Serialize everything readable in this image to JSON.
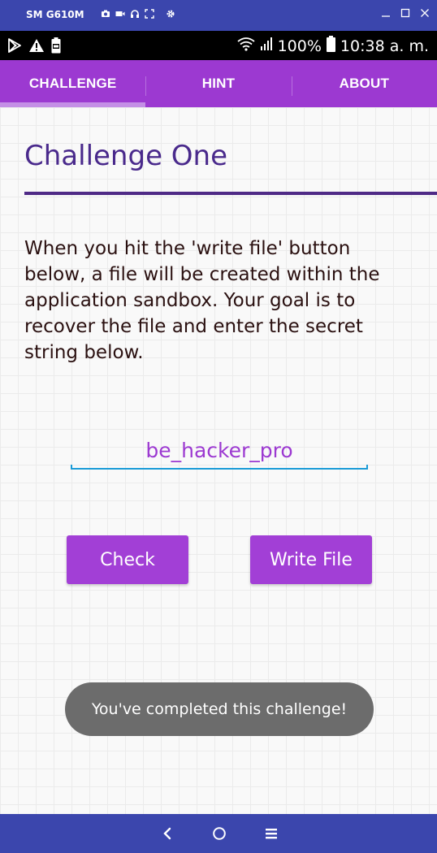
{
  "window": {
    "title": "SM G610M",
    "tool_icons": [
      "camera-icon",
      "video-icon",
      "headphones-icon",
      "fullscreen-icon",
      "settings-gear-icon"
    ],
    "controls": [
      "minimize-icon",
      "maximize-icon",
      "close-icon"
    ]
  },
  "status_bar": {
    "left_icons": [
      "play-store-icon",
      "warning-icon",
      "battery-saver-icon"
    ],
    "battery": "100%",
    "time": "10:38 a. m."
  },
  "tabs": [
    {
      "label": "CHALLENGE",
      "active": true
    },
    {
      "label": "HINT",
      "active": false
    },
    {
      "label": "ABOUT",
      "active": false
    }
  ],
  "main": {
    "title": "Challenge One",
    "description": "When you hit the 'write file' button below, a file will be created within the application sandbox. Your goal is to recover the file and enter the secret string below.",
    "secret_input_value": "be_hacker_pro",
    "check_label": "Check",
    "write_file_label": "Write File",
    "toast": "You've completed this challenge!"
  },
  "nav_bar": {
    "buttons": [
      "back-icon",
      "home-icon",
      "recent-apps-icon"
    ]
  },
  "colors": {
    "accent": "#9c39d1",
    "title": "#4a2a8c",
    "frame": "#3b46ad"
  }
}
